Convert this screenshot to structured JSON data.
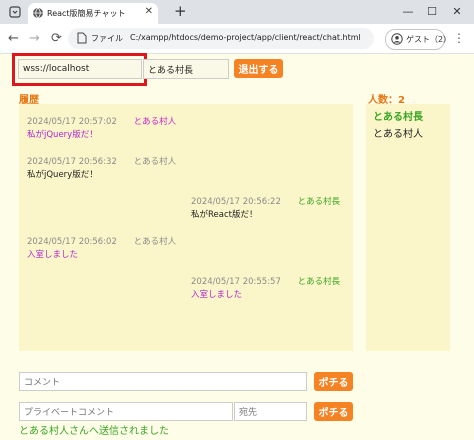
{
  "browser": {
    "tab_title": "React版簡易チャット",
    "new_tab_label": "+",
    "file_label": "ファイル",
    "url": "C:/xampp/htdocs/demo-project/app/client/react/chat.html",
    "guest_label": "ゲスト（2）"
  },
  "connect": {
    "server_url": "wss://localhost",
    "user_name": "とある村長",
    "leave_label": "退出する"
  },
  "history": {
    "label": "履歴",
    "messages": [
      {
        "timestamp": "2024/05/17 20:57:02",
        "name": "とある村人",
        "text": "私がjQuery版だ！"
      },
      {
        "timestamp": "2024/05/17 20:56:32",
        "name": "とある村人",
        "text": "私がjQuery版だ！"
      },
      {
        "timestamp": "2024/05/17 20:56:22",
        "name": "とある村長",
        "text": "私がReact版だ！"
      },
      {
        "timestamp": "2024/05/17 20:56:02",
        "name": "とある村人",
        "text": "入室しました"
      },
      {
        "timestamp": "2024/05/17 20:55:57",
        "name": "とある村長",
        "text": "入室しました"
      }
    ]
  },
  "users": {
    "count_label": "人数：2",
    "list": [
      "とある村長",
      "とある村人"
    ]
  },
  "comment": {
    "placeholder": "コメント",
    "send_label": "ポチる"
  },
  "private": {
    "placeholder": "プライベートコメント",
    "to_placeholder": "宛先",
    "send_label": "ポチる",
    "notice": "とある村人さんへ送信されました"
  },
  "colors": {
    "accent": "#f58223",
    "highlight": "#e0161d",
    "panel": "#fbf6c9",
    "self_name": "#3aa424",
    "other_text": "#b125cf"
  }
}
